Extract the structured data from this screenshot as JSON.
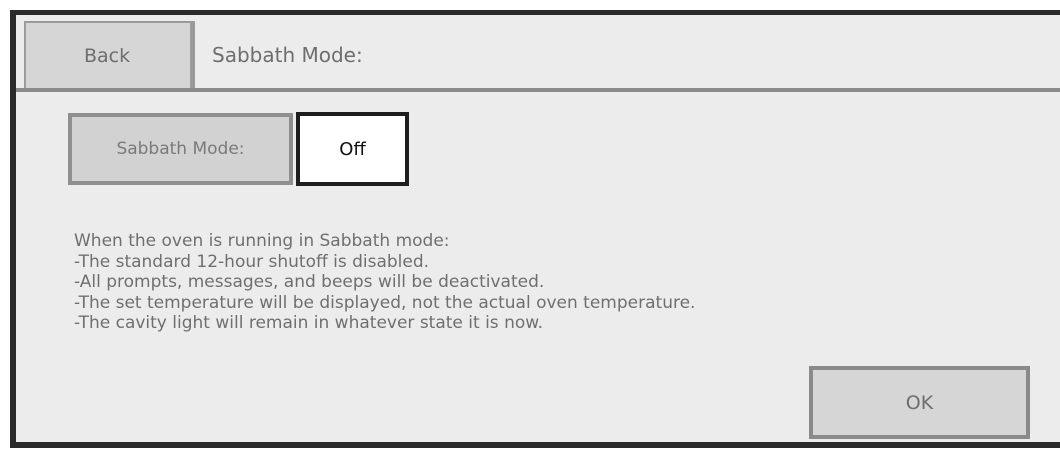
{
  "header": {
    "back_label": "Back",
    "title": "Sabbath Mode:"
  },
  "mode": {
    "label": "Sabbath Mode:",
    "value": "Off"
  },
  "description": {
    "lines": [
      "When the oven is running in Sabbath mode:",
      "-The standard 12-hour shutoff is disabled.",
      "-All prompts, messages, and beeps will be deactivated.",
      "-The set temperature will be displayed, not the actual oven temperature.",
      "-The cavity light will remain in whatever state it is now."
    ]
  },
  "actions": {
    "ok_label": "OK"
  },
  "colors": {
    "frame": "#2b2b2b",
    "panel": "#ececec",
    "button_fill": "#d6d6d6",
    "button_border": "#8a8a8a",
    "value_border": "#1e1e1e",
    "text_muted": "#6e6e6e"
  }
}
